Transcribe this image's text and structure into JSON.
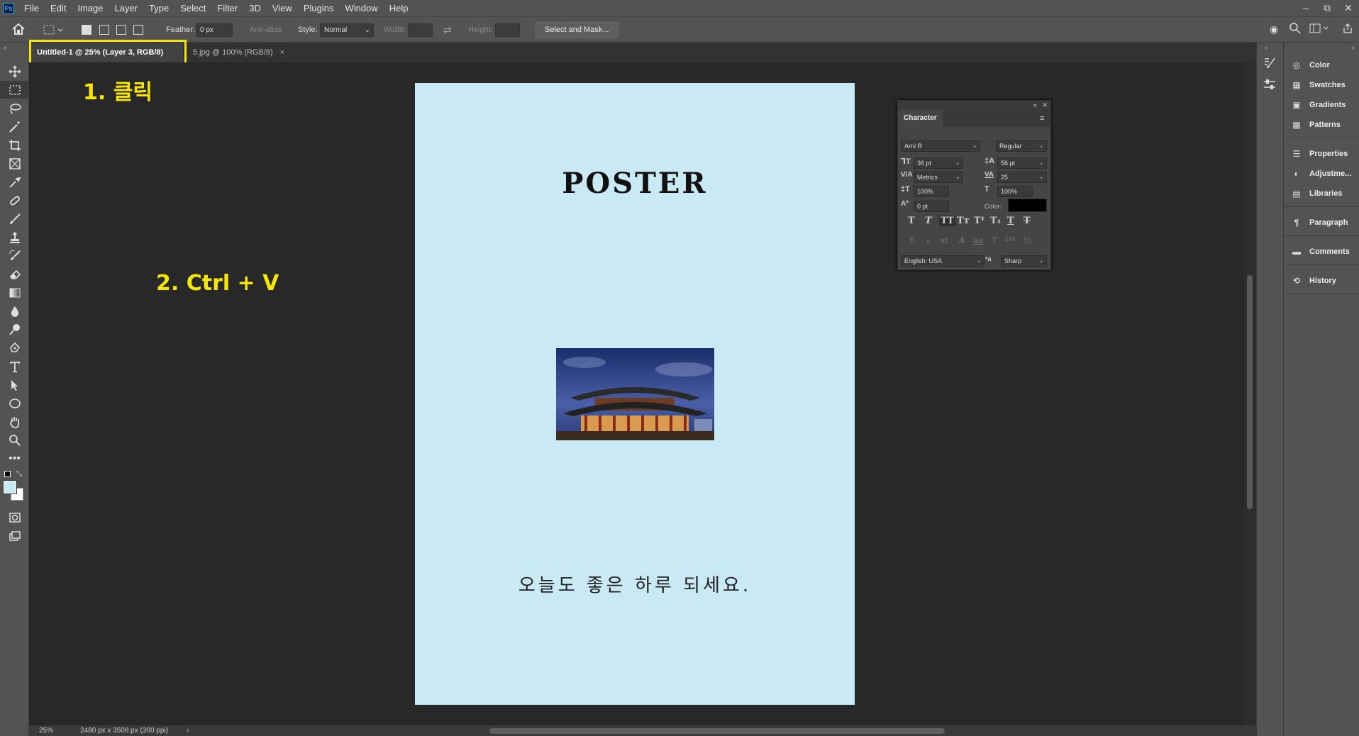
{
  "menubar": {
    "logo": "Ps",
    "items": [
      "File",
      "Edit",
      "Image",
      "Layer",
      "Type",
      "Select",
      "Filter",
      "3D",
      "View",
      "Plugins",
      "Window",
      "Help"
    ],
    "window_buttons": [
      "–",
      "⧉",
      "✕"
    ]
  },
  "options": {
    "feather_label": "Feather:",
    "feather_value": "0 px",
    "antialias_label": "Anti-alias",
    "style_label": "Style:",
    "style_value": "Normal",
    "width_label": "Width:",
    "height_label": "Height:",
    "select_mask_label": "Select and Mask..."
  },
  "tabs": [
    {
      "label": "Untitled-1 @ 25% (Layer 3, RGB/8) *",
      "close": "×",
      "active": true
    },
    {
      "label": "5.jpg @ 100% (RGB/8)",
      "close": "×",
      "active": false
    }
  ],
  "annotations": {
    "step1": "1. 클릭",
    "step2": "2. Ctrl + V",
    "color": "#f7e600"
  },
  "document": {
    "background": "#c9eaf5",
    "title": "POSTER",
    "greeting": "오늘도 좋은 하루 되세요."
  },
  "status": {
    "zoom": "25%",
    "size": "2480 px x 3508 px (300 ppi)",
    "arrow": "›"
  },
  "character_panel": {
    "title": "Character",
    "font_family": "Arni R",
    "font_style": "Regular",
    "font_size": "36 pt",
    "leading": "56 pt",
    "kerning": "Metrics",
    "tracking": "25",
    "vertical_scale": "100%",
    "horizontal_scale": "100%",
    "baseline_shift": "0 pt",
    "color_label": "Color:",
    "color_value": "#000000",
    "language": "English: USA",
    "antialias": "Sharp",
    "style_buttons": [
      "T",
      "T",
      "TT",
      "Tт",
      "T¹",
      "T₁",
      "T",
      "T"
    ],
    "opentype_buttons": [
      "fi",
      "ℴ",
      "st",
      "A",
      "aa",
      "T",
      "1st",
      "½"
    ]
  },
  "panels": [
    {
      "label": "Color",
      "icon": "color-icon"
    },
    {
      "label": "Swatches",
      "icon": "swatches-icon"
    },
    {
      "label": "Gradients",
      "icon": "gradients-icon"
    },
    {
      "label": "Patterns",
      "icon": "patterns-icon"
    },
    {
      "label": "Properties",
      "icon": "properties-icon"
    },
    {
      "label": "Adjustme...",
      "icon": "adjustments-icon"
    },
    {
      "label": "Libraries",
      "icon": "libraries-icon"
    },
    {
      "label": "Paragraph",
      "icon": "paragraph-icon"
    },
    {
      "label": "Comments",
      "icon": "comments-icon"
    },
    {
      "label": "History",
      "icon": "history-icon"
    }
  ],
  "tools": [
    "move-tool-icon",
    "marquee-tool-icon",
    "lasso-tool-icon",
    "magic-wand-tool-icon",
    "crop-tool-icon",
    "frame-tool-icon",
    "eyedropper-tool-icon",
    "healing-brush-tool-icon",
    "brush-tool-icon",
    "clone-stamp-tool-icon",
    "history-brush-tool-icon",
    "eraser-tool-icon",
    "gradient-tool-icon",
    "blur-tool-icon",
    "dodge-tool-icon",
    "pen-tool-icon",
    "type-tool-icon",
    "path-selection-tool-icon",
    "ellipse-tool-icon",
    "hand-tool-icon",
    "zoom-tool-icon",
    "more-tools-icon"
  ],
  "foreground_color": "#c9eaf5",
  "background_color": "#ffffff"
}
